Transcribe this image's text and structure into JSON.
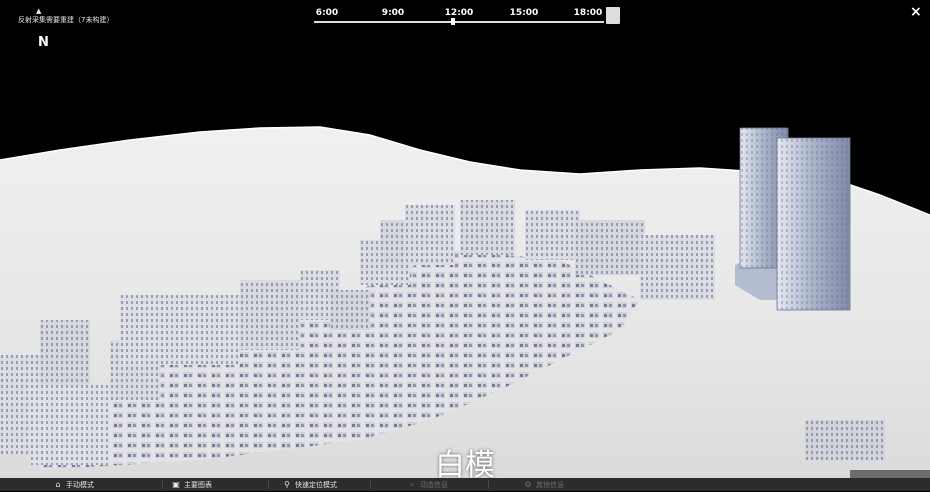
{
  "top_left": {
    "indicator_icon": "triangle-up-icon",
    "text": "反射采集需要重建（7未构建）"
  },
  "compass": {
    "label": "N"
  },
  "timeline": {
    "ticks": [
      "6:00",
      "9:00",
      "12:00",
      "15:00",
      "18:00"
    ],
    "current_fraction": 0.48,
    "play_icon": "play-square-icon"
  },
  "close": {
    "icon": "close-icon",
    "label": "×"
  },
  "caption": "白模",
  "bottom_nav": [
    {
      "label": "手动模式",
      "icon": "home-icon",
      "glyph": "⌂",
      "enabled": true
    },
    {
      "label": "主要图表",
      "icon": "image-icon",
      "glyph": "▣",
      "enabled": true
    },
    {
      "label": "快速定位模式",
      "icon": "location-pin-icon",
      "glyph": "⚲",
      "enabled": true
    },
    {
      "label": "动态信息",
      "icon": "search-icon",
      "glyph": "⌕",
      "enabled": false
    },
    {
      "label": "其他信息",
      "icon": "settings-icon",
      "glyph": "⚙",
      "enabled": false
    }
  ],
  "colors": {
    "background": "#000000",
    "terrain": "#e9e9e9",
    "building": "#dcdde2",
    "building_shadow": "#3e4f77",
    "bar": "#2a2c2e"
  }
}
